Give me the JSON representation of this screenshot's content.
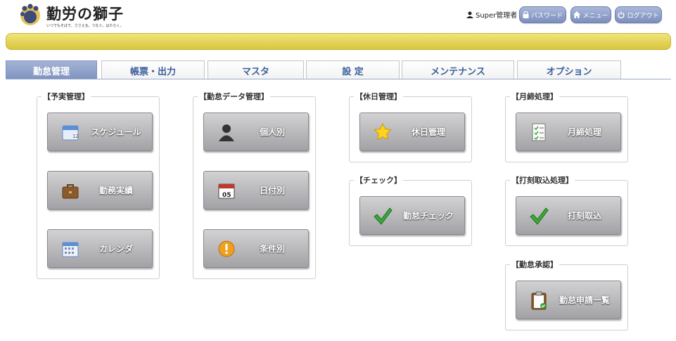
{
  "header": {
    "logo_title": "勤労の獅子",
    "logo_subtitle": "いつでもそばで、ささえる。つなぐ。はたらく。",
    "user_name": "Super管理者",
    "buttons": {
      "password": "パスワード",
      "menu": "メニュー",
      "logout": "ログアウト"
    }
  },
  "tabs": [
    "勤怠管理",
    "帳票・出力",
    "マスタ",
    "設 定",
    "メンテナンス",
    "オプション"
  ],
  "active_tab": 0,
  "groups": {
    "yojitsu": {
      "title": "【予実管理】",
      "buttons": [
        "スケジュール",
        "勤務実績",
        "カレンダ"
      ]
    },
    "kintai_data": {
      "title": "【勤怠データ管理】",
      "buttons": [
        "個人別",
        "日付別",
        "条件別"
      ]
    },
    "kyujitsu": {
      "title": "【休日管理】",
      "buttons": [
        "休日管理"
      ]
    },
    "check": {
      "title": "【チェック】",
      "buttons": [
        "勤怠チェック"
      ]
    },
    "getsuji": {
      "title": "【月締処理】",
      "buttons": [
        "月締処理"
      ]
    },
    "dakoku": {
      "title": "【打刻取込処理】",
      "buttons": [
        "打刻取込"
      ]
    },
    "shonin": {
      "title": "【勤怠承認】",
      "buttons": [
        "勤怠申請一覧"
      ]
    }
  },
  "calendar_day": "05",
  "colors": {
    "accent": "#7f92bf",
    "yellow_bar": "#e3d45a",
    "button_gray": "#a2a2a6"
  }
}
